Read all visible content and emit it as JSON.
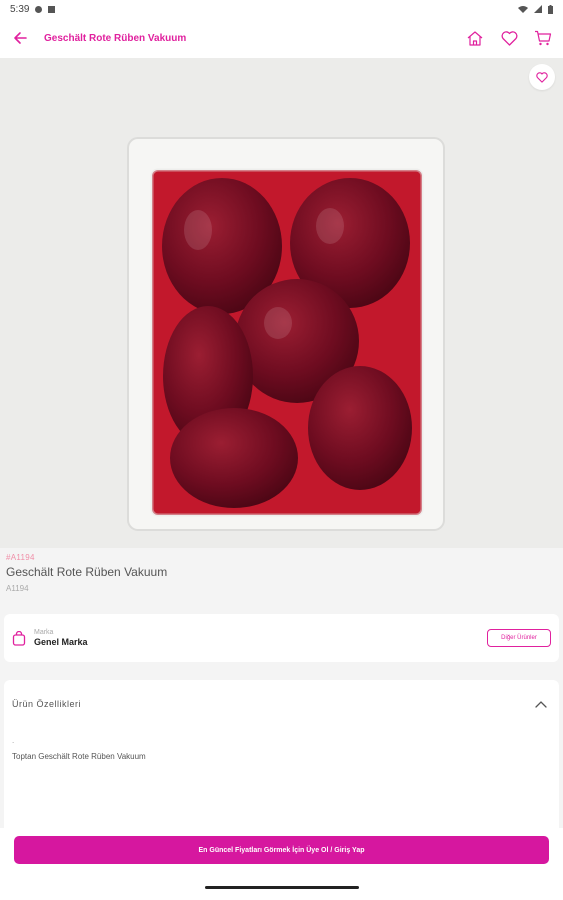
{
  "status_bar": {
    "time": "5:39"
  },
  "app_bar": {
    "title": "Geschält Rote Rüben Vakuum",
    "icons": [
      "back-arrow-icon",
      "home-icon",
      "heart-icon",
      "cart-icon"
    ]
  },
  "product": {
    "code_highlight": "#A1194",
    "name": "Geschält Rote Rüben Vakuum",
    "code": "A1194"
  },
  "brand": {
    "label": "Marka",
    "name": "Genel Marka",
    "other_products_label": "Diğer Ürünler"
  },
  "features": {
    "title": "Ürün Özellikleri",
    "bullet": ".",
    "description": "Toptan Geschält Rote Rüben Vakuum"
  },
  "cta": {
    "label": "En Güncel Fiyatları Görmek İçin Üye Ol / Giriş Yap"
  },
  "colors": {
    "accent": "#e0219e",
    "cta": "#d6179f",
    "beet": "#7a0f24",
    "juice": "#c2182c"
  }
}
